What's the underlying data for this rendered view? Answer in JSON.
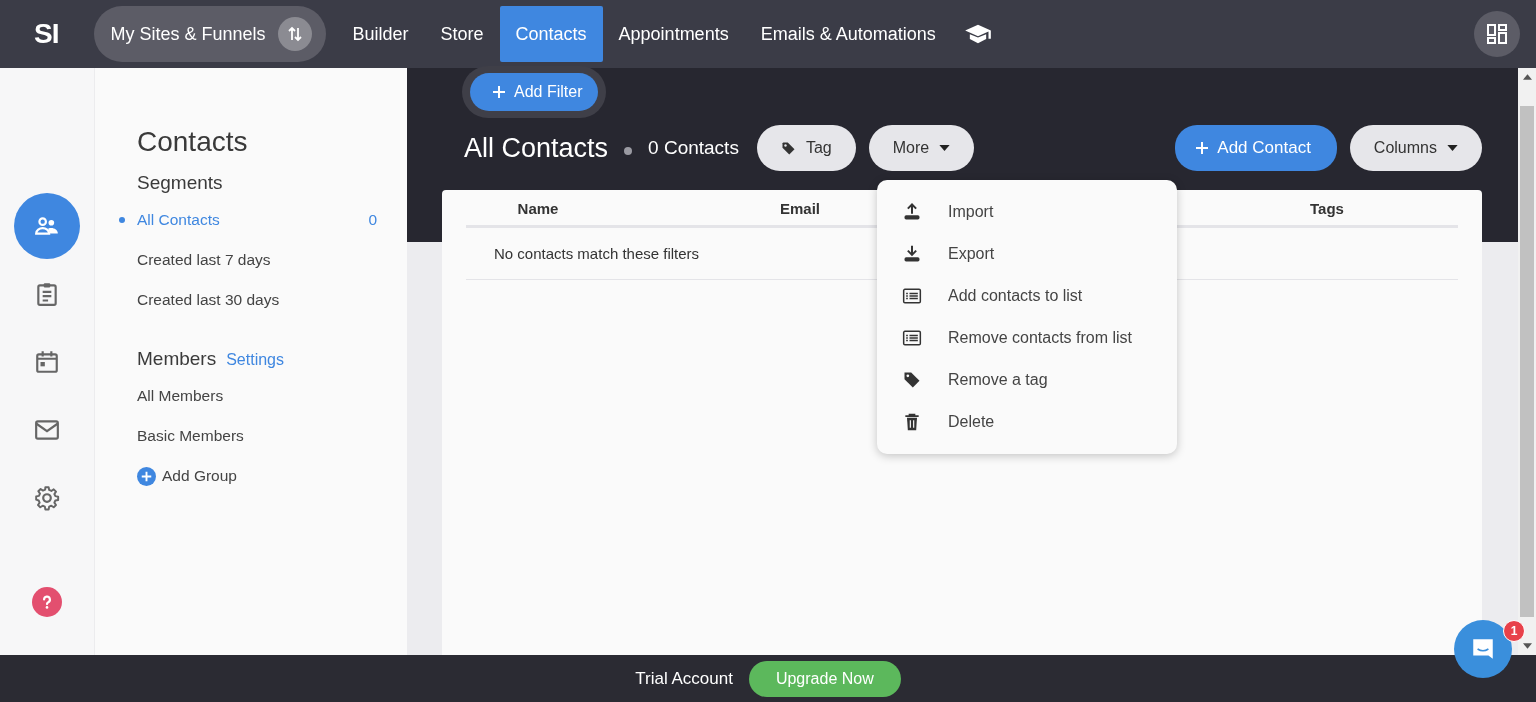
{
  "top_bar": {
    "logo": "SI",
    "site_switcher": "My Sites & Funnels",
    "tabs": [
      {
        "label": "Builder",
        "selected": false
      },
      {
        "label": "Store",
        "selected": false
      },
      {
        "label": "Contacts",
        "selected": true
      },
      {
        "label": "Appointments",
        "selected": false
      },
      {
        "label": "Emails & Automations",
        "selected": false
      }
    ]
  },
  "rail": {
    "items": [
      {
        "selected": true
      },
      {
        "selected": false
      },
      {
        "selected": false
      },
      {
        "selected": false
      },
      {
        "selected": false
      }
    ]
  },
  "sidebar": {
    "title": "Contacts",
    "segments_heading": "Segments",
    "segments": [
      {
        "label": "All Contacts",
        "count": "0",
        "selected": true
      },
      {
        "label": "Created last 7 days",
        "selected": false
      },
      {
        "label": "Created last 30 days",
        "selected": false
      }
    ],
    "members_heading": "Members",
    "settings_link": "Settings",
    "members": [
      {
        "label": "All Members"
      },
      {
        "label": "Basic Members"
      }
    ],
    "add_group": "Add Group"
  },
  "main": {
    "add_filter": "Add Filter",
    "title": "All Contacts",
    "count": "0 Contacts",
    "tag_button": "Tag",
    "more_button": "More",
    "add_contact": "Add Contact",
    "columns_button": "Columns",
    "table": {
      "columns": [
        "Name",
        "Email",
        "Tags"
      ],
      "empty_message": "No contacts match these filters"
    },
    "more_menu": [
      "Import",
      "Export",
      "Add contacts to list",
      "Remove contacts from list",
      "Remove a tag",
      "Delete"
    ]
  },
  "chat": {
    "badge": "1"
  },
  "bottom_bar": {
    "label": "Trial Account",
    "upgrade": "Upgrade Now"
  }
}
